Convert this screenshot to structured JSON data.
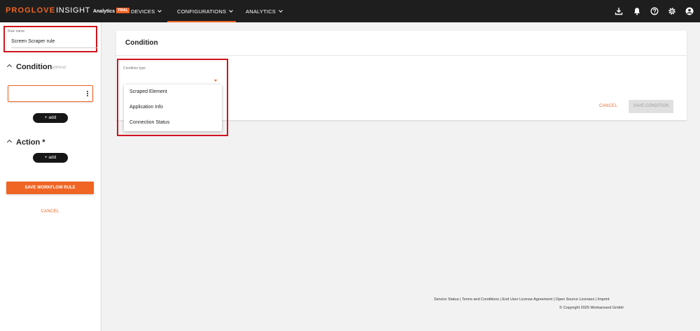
{
  "brand": {
    "name_part1": "PROGLOVE",
    "name_part2": "INSIGHT",
    "product": "Analytics",
    "badge": "TRIAL"
  },
  "nav": {
    "devices": "DEVICES",
    "configurations": "CONFIGURATIONS",
    "analytics": "ANALYTICS"
  },
  "topbar_icons": [
    "download-icon",
    "bell-icon",
    "help-icon",
    "settings-icon",
    "account-icon"
  ],
  "rule": {
    "label": "Rule name",
    "value": "Screen Scraper rule"
  },
  "condition_section": {
    "title": "Condition",
    "optional": "optional",
    "add_label": "+ add"
  },
  "action_section": {
    "title": "Action *",
    "add_label": "+ add"
  },
  "left_buttons": {
    "save": "SAVE WORKFLOW RULE",
    "cancel": "CANCEL"
  },
  "card": {
    "title": "Condition",
    "condition_type_label": "Condition type",
    "options": [
      "Scraped Element",
      "Application Info",
      "Connection Status"
    ],
    "cancel": "CANCEL",
    "save": "SAVE CONDITION"
  },
  "footer": {
    "links": "Service Status | Terms and Conditions | End User License Agreement | Open Source Licenses | Imprint",
    "copyright": "© Copyright 2025 Workaround GmbH"
  },
  "colors": {
    "accent": "#f06424",
    "topbar": "#1e1e1e",
    "highlight": "#d0141e"
  }
}
